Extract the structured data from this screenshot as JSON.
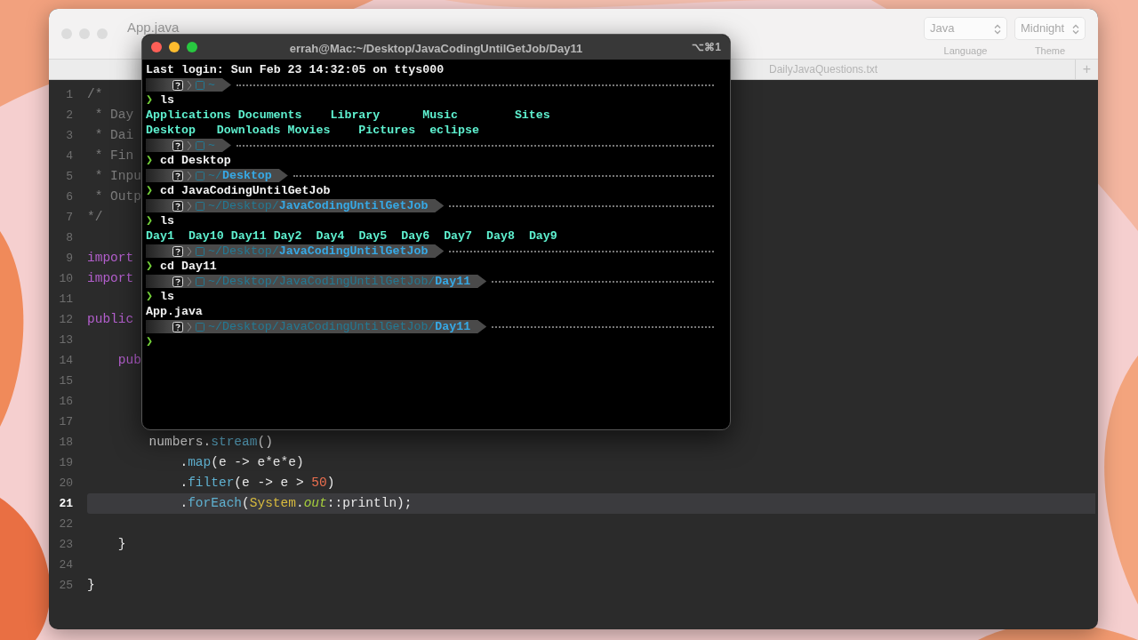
{
  "editor": {
    "title": "App.java",
    "language": {
      "value": "Java",
      "label": "Language"
    },
    "theme": {
      "value": "Midnight",
      "label": "Theme"
    },
    "tabs": [
      {
        "label": "DailyJavaQuestions.txt",
        "selected": false
      }
    ],
    "new_tab": "+",
    "lines": [
      {
        "number": "1",
        "current": false,
        "tokens": [
          {
            "kind": "comment",
            "text": "/*"
          }
        ]
      },
      {
        "number": "2",
        "current": false,
        "tokens": [
          {
            "kind": "comment",
            "text": " * Day"
          }
        ]
      },
      {
        "number": "3",
        "current": false,
        "tokens": [
          {
            "kind": "comment",
            "text": " * Dai"
          }
        ]
      },
      {
        "number": "4",
        "current": false,
        "tokens": [
          {
            "kind": "comment",
            "text": " * Fin"
          }
        ]
      },
      {
        "number": "5",
        "current": false,
        "tokens": [
          {
            "kind": "comment",
            "text": " * Inpu"
          }
        ]
      },
      {
        "number": "6",
        "current": false,
        "tokens": [
          {
            "kind": "comment",
            "text": " * Outp"
          }
        ]
      },
      {
        "number": "7",
        "current": false,
        "tokens": [
          {
            "kind": "comment",
            "text": "*/"
          }
        ]
      },
      {
        "number": "8",
        "current": false
      },
      {
        "number": "9",
        "current": false,
        "tokens": [
          {
            "kind": "keyword",
            "text": "import"
          }
        ]
      },
      {
        "number": "10",
        "current": false,
        "tokens": [
          {
            "kind": "keyword",
            "text": "import"
          }
        ]
      },
      {
        "number": "11",
        "current": false
      },
      {
        "number": "12",
        "current": false,
        "tokens": [
          {
            "kind": "keyword",
            "text": "public"
          }
        ]
      },
      {
        "number": "13",
        "current": false
      },
      {
        "number": "14",
        "current": false,
        "tokens": [
          {
            "kind": "keyword",
            "text": "    pub"
          }
        ]
      },
      {
        "number": "15",
        "current": false
      },
      {
        "number": "16",
        "current": false
      },
      {
        "number": "17",
        "current": false
      },
      {
        "number": "18",
        "current": false,
        "tokens": [
          {
            "kind": "plain",
            "text": "        numbers."
          },
          {
            "kind": "method",
            "text": "stream"
          },
          {
            "kind": "plain",
            "text": "()"
          }
        ]
      },
      {
        "number": "19",
        "current": false,
        "tokens": [
          {
            "kind": "plain",
            "text": "            ."
          },
          {
            "kind": "method",
            "text": "map"
          },
          {
            "kind": "plain",
            "text": "(e -> e*e*e)"
          }
        ]
      },
      {
        "number": "20",
        "current": false,
        "tokens": [
          {
            "kind": "plain",
            "text": "            ."
          },
          {
            "kind": "method",
            "text": "filter"
          },
          {
            "kind": "plain",
            "text": "(e -> e > "
          },
          {
            "kind": "number",
            "text": "50"
          },
          {
            "kind": "plain",
            "text": ")"
          }
        ]
      },
      {
        "number": "21",
        "current": true,
        "tokens": [
          {
            "kind": "plain",
            "text": "            ."
          },
          {
            "kind": "method",
            "text": "forEach"
          },
          {
            "kind": "plain",
            "text": "("
          },
          {
            "kind": "class",
            "text": "System"
          },
          {
            "kind": "plain",
            "text": "."
          },
          {
            "kind": "static",
            "text": "out"
          },
          {
            "kind": "plain",
            "text": "::println);"
          }
        ]
      },
      {
        "number": "22",
        "current": false
      },
      {
        "number": "23",
        "current": false,
        "tokens": [
          {
            "kind": "plain",
            "text": "    }"
          }
        ]
      },
      {
        "number": "24",
        "current": false
      },
      {
        "number": "25",
        "current": false,
        "tokens": [
          {
            "kind": "plain",
            "text": "}"
          }
        ]
      }
    ]
  },
  "terminal": {
    "title": "errah@Mac:~/Desktop/JavaCodingUntilGetJob/Day11",
    "shortcut": "⌥⌘1",
    "lines": [
      {
        "kind": "text",
        "text": "Last login: Sun Feb 23 14:32:05 on ttys000"
      },
      {
        "kind": "prompt_bar",
        "path_dim": "~"
      },
      {
        "kind": "command",
        "prompt": "❯",
        "text": "ls"
      },
      {
        "kind": "listing",
        "items": [
          "Applications",
          "Documents",
          "Library",
          "Music",
          "Sites"
        ]
      },
      {
        "kind": "listing",
        "items": [
          "Desktop",
          "Downloads",
          "Movies",
          "Pictures",
          "eclipse"
        ]
      },
      {
        "kind": "prompt_bar",
        "path_dim": "~"
      },
      {
        "kind": "command",
        "prompt": "❯",
        "text": "cd Desktop"
      },
      {
        "kind": "prompt_bar",
        "path_dim": "~/",
        "path_bold": "Desktop"
      },
      {
        "kind": "command",
        "prompt": "❯",
        "text": "cd JavaCodingUntilGetJob"
      },
      {
        "kind": "prompt_bar",
        "path_dim": "~/Desktop/",
        "path_bold": "JavaCodingUntilGetJob"
      },
      {
        "kind": "command",
        "prompt": "❯",
        "text": "ls"
      },
      {
        "kind": "listing",
        "items": [
          "Day1",
          "Day10",
          "Day11",
          "Day2",
          "Day4",
          "Day5",
          "Day6",
          "Day7",
          "Day8",
          "Day9"
        ]
      },
      {
        "kind": "prompt_bar",
        "path_dim": "~/Desktop/",
        "path_bold": "JavaCodingUntilGetJob"
      },
      {
        "kind": "command",
        "prompt": "❯",
        "text": "cd Day11"
      },
      {
        "kind": "prompt_bar",
        "path_dim": "~/Desktop/JavaCodingUntilGetJob/",
        "path_bold": "Day11"
      },
      {
        "kind": "command",
        "prompt": "❯",
        "text": "ls"
      },
      {
        "kind": "text",
        "text": "App.java"
      },
      {
        "kind": "prompt_bar",
        "path_dim": "~/Desktop/JavaCodingUntilGetJob/",
        "path_bold": "Day11"
      },
      {
        "kind": "command",
        "prompt": "❯"
      }
    ]
  }
}
